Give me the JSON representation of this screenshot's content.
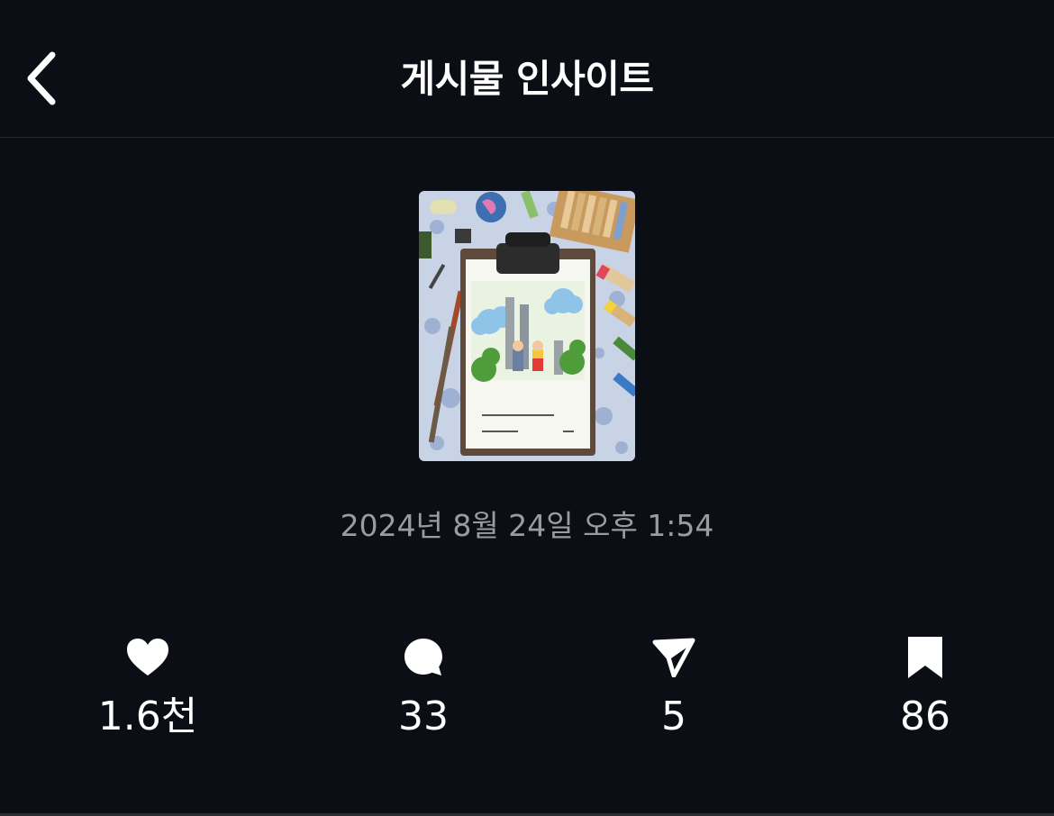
{
  "header": {
    "title": "게시물 인사이트",
    "back_icon": "chevron-left-icon"
  },
  "post": {
    "thumbnail_alt": "post-thumbnail",
    "timestamp": "2024년 8월 24일 오후 1:54"
  },
  "stats": [
    {
      "icon": "heart-icon",
      "value": "1.6천"
    },
    {
      "icon": "comment-icon",
      "value": "33"
    },
    {
      "icon": "share-icon",
      "value": "5"
    },
    {
      "icon": "bookmark-icon",
      "value": "86"
    }
  ],
  "colors": {
    "background": "#0b0e14",
    "text": "#ffffff",
    "muted": "#9a9ca3",
    "divider": "#23262d"
  }
}
